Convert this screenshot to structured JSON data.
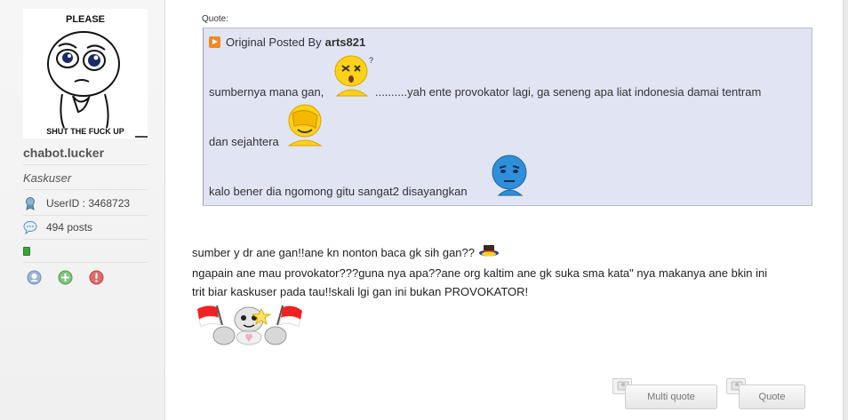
{
  "sidebar": {
    "avatar_text_top": "PLEASE",
    "avatar_text_bottom": "SHUT THE FUCK UP",
    "username": "chabot.lucker",
    "user_title": "Kaskuser",
    "user_id": "UserID : 3468723",
    "posts": "494 posts",
    "online_status_color": "#3aa53a",
    "action_icons": [
      "profile-icon",
      "add-reputation-icon",
      "report-icon"
    ]
  },
  "quote": {
    "label": "Quote:",
    "prefix": "Original Posted By",
    "author": "arts821",
    "line1_a": "sumbernya mana gan,",
    "line1_b": " ..........yah ente provokator lagi, ga seneng apa liat indonesia damai tentram",
    "line2": "dan sejahtera",
    "line3": "kalo bener dia ngomong gitu sangat2 disayangkan"
  },
  "post": {
    "line1": "sumber y dr ane gan!!ane kn nonton baca gk sih gan??",
    "line2": "ngapain ane mau provokator???guna nya apa??ane org kaltim ane gk suka sma kata\" nya makanya ane bkin ini",
    "line3": "trit biar kaskuser pada tau!!skali lgi gan ini bukan PROVOKATOR!"
  },
  "buttons": {
    "multi_quote": "Multi quote",
    "quote": "Quote"
  },
  "colors": {
    "quote_bg": "#e1e4f2",
    "quote_border": "#b8bcd6",
    "accent_orange": "#f08a24"
  }
}
